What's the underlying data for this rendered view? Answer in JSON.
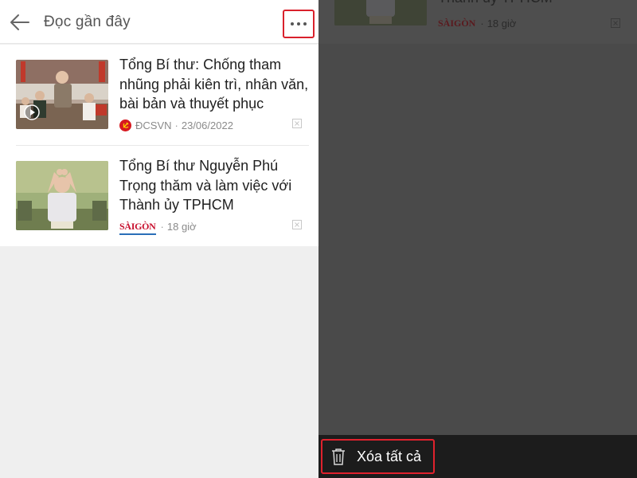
{
  "header": {
    "title": "Đọc gần đây",
    "back_icon": "arrow-left-icon",
    "more_icon": "more-horizontal-icon",
    "highlight_color": "#d9212c"
  },
  "articles": [
    {
      "headline": "Tổng Bí thư: Chống tham nhũng phải kiên trì, nhân văn, bài bản và thuyết phục",
      "source": "ĐCSVN",
      "source_logo": "hammer-sickle-icon",
      "time": "23/06/2022",
      "has_video": true,
      "remove_icon": "close-box-icon"
    },
    {
      "headline": "Tổng Bí thư Nguyễn Phú Trọng thăm và làm việc với Thành ủy TPHCM",
      "source": "SÀIGÒN",
      "source_logo": "saigon-giai-phong-logo",
      "time": "18 giờ",
      "has_video": false,
      "remove_icon": "close-box-icon"
    }
  ],
  "overlay": {
    "partial_headline": "Thành ủy TPHCM",
    "partial_source": "SÀIGÒN",
    "partial_time": "18 giờ"
  },
  "bottom_sheet": {
    "delete_all_label": "Xóa tất cả",
    "delete_icon": "trash-icon"
  },
  "colors": {
    "brand_red": "#d71920",
    "background_gray": "#efefef",
    "dim_overlay": "#4a4a4a",
    "sheet_background": "#1c1c1c"
  }
}
